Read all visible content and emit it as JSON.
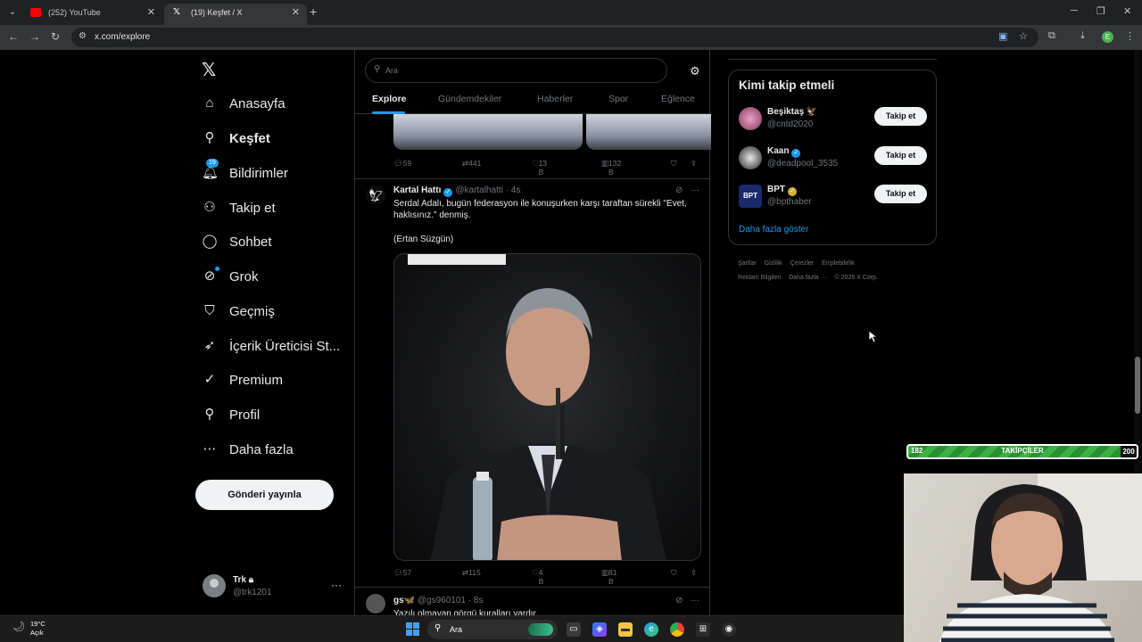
{
  "browser": {
    "tabs": [
      {
        "title": "(252) YouTube",
        "active": false,
        "favicon": "youtube-icon"
      },
      {
        "title": "(19) Keşfet / X",
        "active": true,
        "favicon": "x-icon"
      }
    ],
    "url": "x.com/explore",
    "profile_initial": "E"
  },
  "sidebar": {
    "items": [
      {
        "label": "Anasayfa",
        "icon": "home-icon"
      },
      {
        "label": "Keşfet",
        "icon": "search-icon",
        "active": true
      },
      {
        "label": "Bildirimler",
        "icon": "bell-icon",
        "badge": "19"
      },
      {
        "label": "Takip et",
        "icon": "add-person-icon"
      },
      {
        "label": "Sohbet",
        "icon": "chat-icon"
      },
      {
        "label": "Grok",
        "icon": "grok-icon"
      },
      {
        "label": "Geçmiş",
        "icon": "bookmark-icon"
      },
      {
        "label": "İçerik Üreticisi St...",
        "icon": "rocket-icon"
      },
      {
        "label": "Premium",
        "icon": "verified-icon"
      },
      {
        "label": "Profil",
        "icon": "person-icon"
      },
      {
        "label": "Daha fazla",
        "icon": "more-circle-icon"
      }
    ],
    "post_button": "Gönderi yayınla",
    "account": {
      "name": "Trk",
      "handle": "@trk1201"
    }
  },
  "main": {
    "search_placeholder": "Ara",
    "tabs": [
      "Explore",
      "Gündemdekiler",
      "Haberler",
      "Spor",
      "Eğlence"
    ],
    "tweet0_stats": {
      "replies": "59",
      "retweets": "441",
      "likes": "13 B",
      "views": "132 B"
    },
    "tweet1": {
      "name": "Kartal Hattı",
      "handle": "@kartalhatti",
      "time": "· 4s",
      "text1": "Serdal Adalı, bugün federasyon ile konuşurken karşı taraftan sürekli \"Evet, haklısınız.\" denmiş.",
      "text2": "(Ertan Süzgün)",
      "stats": {
        "replies": "57",
        "retweets": "115",
        "likes": "4 B",
        "views": "81 B"
      }
    },
    "tweet2": {
      "name": "gs🦋",
      "handle": "@gs960101",
      "time": "· 8s",
      "text": "Yazılı olmayan görgü kuralları vardır."
    }
  },
  "right": {
    "who_to_follow_title": "Kimi takip etmeli",
    "accounts": [
      {
        "name": "Beşiktaş 🦅",
        "handle": "@cntd2020",
        "button": "Takip et",
        "verified": ""
      },
      {
        "name": "Kaan",
        "handle": "@deadpool_3535",
        "button": "Takip et",
        "verified": "blue"
      },
      {
        "name": "BPT",
        "handle": "@bpthaber",
        "button": "Takip et",
        "verified": "gold"
      }
    ],
    "show_more": "Daha fazla göster",
    "footer": [
      "Şartlar",
      "Gizlilik",
      "Çerezler",
      "Erişilebilirlik",
      "Reklam Bilgileri",
      "Daha fazla ···",
      "© 2026 X Corp."
    ]
  },
  "overlay": {
    "goal_current": "182",
    "goal_label": "TAKİPÇİLER",
    "goal_target": "200",
    "goal_progress": 0.91
  },
  "taskbar": {
    "temperature": "19°C",
    "condition": "Açık",
    "search_label": "Ara"
  },
  "colors": {
    "accent": "#1d9bf0",
    "background": "#000000",
    "border": "#2f3336",
    "muted": "#71767b"
  }
}
